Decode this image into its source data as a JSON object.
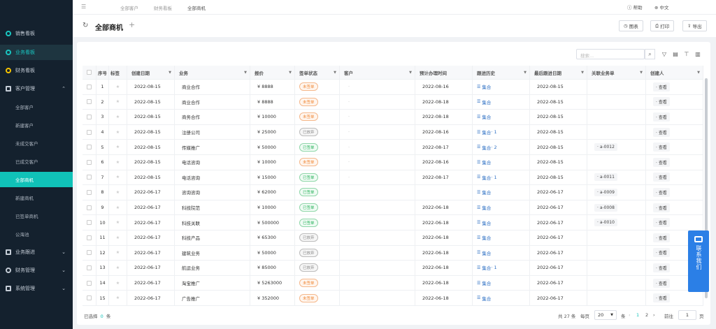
{
  "sidebar": {
    "items": [
      {
        "label": "销售看板"
      },
      {
        "label": "业务看板"
      },
      {
        "label": "财务看板"
      },
      {
        "label": "客户管理"
      },
      {
        "label": "业务跟进"
      },
      {
        "label": "财务管理"
      },
      {
        "label": "系统管理"
      }
    ],
    "subitems": [
      {
        "label": "全部客户"
      },
      {
        "label": "新建客户"
      },
      {
        "label": "未成交客户"
      },
      {
        "label": "已成交客户"
      },
      {
        "label": "全部商机"
      },
      {
        "label": "新建商机"
      },
      {
        "label": "已签单商机"
      },
      {
        "label": "公海池"
      }
    ]
  },
  "topbar": {
    "breadcrumbs": [
      "全部客户",
      "财务看板",
      "全部商机"
    ],
    "help": "帮助",
    "lang": "中文"
  },
  "header": {
    "title": "全部商机",
    "chart_btn": "图表",
    "print_btn": "打印",
    "export_btn": "导出"
  },
  "search": {
    "placeholder": "搜索..."
  },
  "table": {
    "headers": [
      "序号",
      "标签",
      "创建日期",
      "业务",
      "报价",
      "签单状态",
      "客户",
      "预计办理时间",
      "跟进历史",
      "最后跟进日期",
      "关联业务单",
      "创建人"
    ],
    "rows": [
      {
        "no": "1",
        "date": "2022-08-15",
        "biz": "商业合作",
        "price": "¥ 8888",
        "status": "未签单",
        "tone": "orange",
        "cust": "·",
        "plan": "2022-08-16",
        "hist": "集合",
        "hcount": "",
        "last": "2022-08-15",
        "order": "",
        "view": "· 查看"
      },
      {
        "no": "2",
        "date": "2022-08-15",
        "biz": "商业合作",
        "price": "¥ 8888",
        "status": "未签单",
        "tone": "orange",
        "cust": "·",
        "plan": "2022-08-18",
        "hist": "集合",
        "hcount": "",
        "last": "2022-08-15",
        "order": "",
        "view": "· 查看"
      },
      {
        "no": "3",
        "date": "2022-08-15",
        "biz": "商务合作",
        "price": "¥ 10000",
        "status": "未签单",
        "tone": "orange",
        "cust": "·",
        "plan": "2022-08-18",
        "hist": "集合",
        "hcount": "",
        "last": "2022-08-15",
        "order": "",
        "view": "· 查看"
      },
      {
        "no": "4",
        "date": "2022-08-15",
        "biz": "注册公司",
        "price": "¥ 25000",
        "status": "已放弃",
        "tone": "gray",
        "cust": "·",
        "plan": "2022-08-16",
        "hist": "集合",
        "hcount": "· 1",
        "last": "2022-08-15",
        "order": "",
        "view": "· 查看"
      },
      {
        "no": "5",
        "date": "2022-08-15",
        "biz": "传媒推广",
        "price": "¥ 50000",
        "status": "已签单",
        "tone": "green",
        "cust": "·",
        "plan": "2022-08-17",
        "hist": "集合",
        "hcount": "· 2",
        "last": "2022-08-15",
        "order": "· a-0012",
        "view": "· 查看"
      },
      {
        "no": "6",
        "date": "2022-08-15",
        "biz": "电话咨询",
        "price": "¥ 10000",
        "status": "未签单",
        "tone": "orange",
        "cust": "·",
        "plan": "2022-08-16",
        "hist": "集合",
        "hcount": "",
        "last": "2022-08-15",
        "order": "",
        "view": "· 查看"
      },
      {
        "no": "7",
        "date": "2022-08-15",
        "biz": "电话咨询",
        "price": "¥ 15000",
        "status": "已签单",
        "tone": "green",
        "cust": "·",
        "plan": "2022-08-17",
        "hist": "集合",
        "hcount": "· 1",
        "last": "2022-08-15",
        "order": "· a-0011",
        "view": "· 查看"
      },
      {
        "no": "8",
        "date": "2022-06-17",
        "biz": "咨询咨询",
        "price": "¥ 62000",
        "status": "已签单",
        "tone": "green",
        "cust": "",
        "plan": "",
        "hist": "集合",
        "hcount": "",
        "last": "2022-06-17",
        "order": "· a-0009",
        "view": "· 查看"
      },
      {
        "no": "9",
        "date": "2022-06-17",
        "biz": "科技院范",
        "price": "¥ 10000",
        "status": "已签单",
        "tone": "green",
        "cust": "",
        "plan": "2022-06-18",
        "hist": "集合",
        "hcount": "",
        "last": "2022-06-17",
        "order": "· a-0008",
        "view": "· 查看"
      },
      {
        "no": "10",
        "date": "2022-06-17",
        "biz": "科技关联",
        "price": "¥ 500000",
        "status": "已签单",
        "tone": "green",
        "cust": "",
        "plan": "2022-06-18",
        "hist": "集合",
        "hcount": "",
        "last": "2022-06-17",
        "order": "· a-0010",
        "view": "· 查看"
      },
      {
        "no": "11",
        "date": "2022-06-17",
        "biz": "科技产品",
        "price": "¥ 65300",
        "status": "已放弃",
        "tone": "gray",
        "cust": "",
        "plan": "2022-06-18",
        "hist": "集合",
        "hcount": "",
        "last": "2022-06-17",
        "order": "",
        "view": "· 查看"
      },
      {
        "no": "12",
        "date": "2022-06-17",
        "biz": "建筑业务",
        "price": "¥ 50000",
        "status": "已放弃",
        "tone": "gray",
        "cust": "",
        "plan": "2022-06-18",
        "hist": "集合",
        "hcount": "",
        "last": "2022-06-17",
        "order": "",
        "view": "· 查看"
      },
      {
        "no": "13",
        "date": "2022-06-17",
        "biz": "航运业务",
        "price": "¥ 85000",
        "status": "已放弃",
        "tone": "gray",
        "cust": "",
        "plan": "2022-06-18",
        "hist": "集合",
        "hcount": "· 1",
        "last": "2022-06-17",
        "order": "",
        "view": "· 查看"
      },
      {
        "no": "14",
        "date": "2022-06-17",
        "biz": "淘宝推广",
        "price": "¥ 5263000",
        "status": "未签单",
        "tone": "orange",
        "cust": "",
        "plan": "2022-06-18",
        "hist": "集合",
        "hcount": "",
        "last": "2022-06-17",
        "order": "",
        "view": "· 查看"
      },
      {
        "no": "15",
        "date": "2022-06-17",
        "biz": "广告推广",
        "price": "¥ 352000",
        "status": "未签单",
        "tone": "orange",
        "cust": "",
        "plan": "2022-06-18",
        "hist": "集合",
        "hcount": "",
        "last": "2022-06-17",
        "order": "",
        "view": "· 查看"
      }
    ]
  },
  "footer": {
    "selected_label": "已选择",
    "selected_count": "0",
    "selected_unit": "条",
    "total": "共 27 条",
    "per_page_label": "每页",
    "per_page": "20",
    "per_page_unit": "条",
    "page1": "1",
    "page2": "2",
    "goto_label": "前往",
    "goto_value": "1",
    "goto_unit": "页"
  },
  "contact": {
    "label": "联系我们"
  }
}
